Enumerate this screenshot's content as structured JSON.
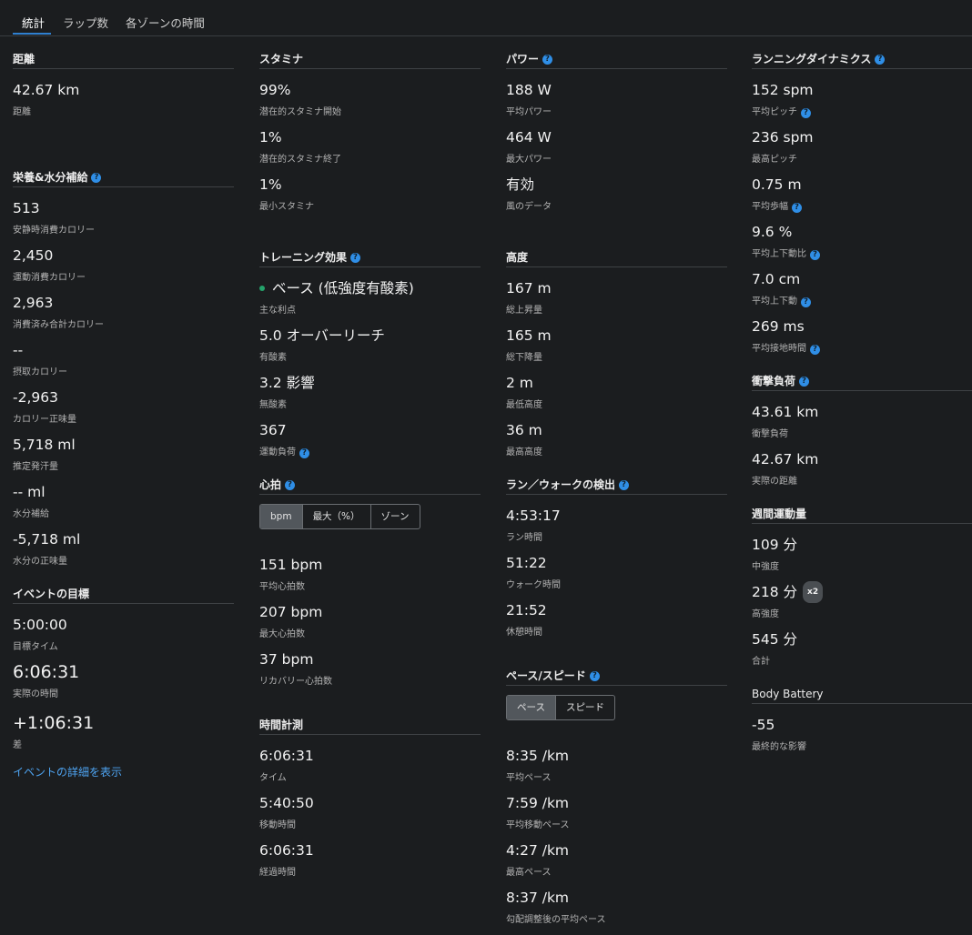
{
  "tabs": [
    "統計",
    "ラップ数",
    "各ゾーンの時間"
  ],
  "col1": {
    "distance": {
      "title": "距離",
      "items": [
        {
          "value": "42.67 km",
          "label": "距離"
        }
      ]
    },
    "nutrition": {
      "title": "栄養&水分補給",
      "items": [
        {
          "value": "513",
          "label": "安静時消費カロリー"
        },
        {
          "value": "2,450",
          "label": "運動消費カロリー"
        },
        {
          "value": "2,963",
          "label": "消費済み合計カロリー"
        },
        {
          "value": "--",
          "label": "摂取カロリー"
        },
        {
          "value": "-2,963",
          "label": "カロリー正味量"
        },
        {
          "value": "5,718 ml",
          "label": "推定発汗量"
        },
        {
          "value": "-- ml",
          "label": "水分補給"
        },
        {
          "value": "-5,718 ml",
          "label": "水分の正味量"
        }
      ]
    },
    "event": {
      "title": "イベントの目標",
      "items": [
        {
          "value": "5:00:00",
          "label": "目標タイム"
        },
        {
          "value": "6:06:31",
          "label": "実際の時間"
        },
        {
          "value": "+1:06:31",
          "label": "差"
        }
      ],
      "link": "イベントの詳細を表示"
    }
  },
  "col2": {
    "stamina": {
      "title": "スタミナ",
      "items": [
        {
          "value": "99%",
          "label": "潜在的スタミナ開始"
        },
        {
          "value": "1%",
          "label": "潜在的スタミナ終了"
        },
        {
          "value": "1%",
          "label": "最小スタミナ"
        }
      ]
    },
    "training": {
      "title": "トレーニング効果",
      "items": [
        {
          "value": "ベース (低強度有酸素)",
          "label": "主な利点"
        },
        {
          "value": "5.0 オーバーリーチ",
          "label": "有酸素"
        },
        {
          "value": "3.2 影響",
          "label": "無酸素"
        },
        {
          "value": "367",
          "label": "運動負荷"
        }
      ],
      "dot_color": "#24a36b"
    },
    "hr": {
      "title": "心拍",
      "toggle": [
        "bpm",
        "最大（%）",
        "ゾーン"
      ],
      "items": [
        {
          "value": "151 bpm",
          "label": "平均心拍数"
        },
        {
          "value": "207 bpm",
          "label": "最大心拍数"
        },
        {
          "value": "37 bpm",
          "label": "リカバリー心拍数"
        }
      ]
    },
    "timing": {
      "title": "時間計測",
      "items": [
        {
          "value": "6:06:31",
          "label": "タイム"
        },
        {
          "value": "5:40:50",
          "label": "移動時間"
        },
        {
          "value": "6:06:31",
          "label": "経過時間"
        }
      ]
    }
  },
  "col3": {
    "power": {
      "title": "パワー",
      "items": [
        {
          "value": "188 W",
          "label": "平均パワー"
        },
        {
          "value": "464 W",
          "label": "最大パワー"
        },
        {
          "value": "有効",
          "label": "風のデータ"
        }
      ]
    },
    "elevation": {
      "title": "高度",
      "items": [
        {
          "value": "167 m",
          "label": "総上昇量"
        },
        {
          "value": "165 m",
          "label": "総下降量"
        },
        {
          "value": "2 m",
          "label": "最低高度"
        },
        {
          "value": "36 m",
          "label": "最高高度"
        }
      ]
    },
    "runwalk": {
      "title": "ラン／ウォークの検出",
      "items": [
        {
          "value": "4:53:17",
          "label": "ラン時間"
        },
        {
          "value": "51:22",
          "label": "ウォーク時間"
        },
        {
          "value": "21:52",
          "label": "休憩時間"
        }
      ]
    },
    "pace": {
      "title": "ペース/スピード",
      "toggle": [
        "ペース",
        "スピード"
      ],
      "items": [
        {
          "value": "8:35 /km",
          "label": "平均ペース"
        },
        {
          "value": "7:59 /km",
          "label": "平均移動ペース"
        },
        {
          "value": "4:27 /km",
          "label": "最高ペース"
        },
        {
          "value": "8:37 /km",
          "label": "勾配調整後の平均ペース"
        }
      ]
    }
  },
  "col4": {
    "dynamics": {
      "title": "ランニングダイナミクス",
      "items": [
        {
          "value": "152 spm",
          "label": "平均ピッチ"
        },
        {
          "value": "236 spm",
          "label": "最高ピッチ"
        },
        {
          "value": "0.75 m",
          "label": "平均歩幅"
        },
        {
          "value": "9.6 %",
          "label": "平均上下動比"
        },
        {
          "value": "7.0 cm",
          "label": "平均上下動"
        },
        {
          "value": "269 ms",
          "label": "平均接地時間"
        }
      ]
    },
    "impact": {
      "title": "衝撃負荷",
      "items": [
        {
          "value": "43.61 km",
          "label": "衝撃負荷"
        },
        {
          "value": "42.67 km",
          "label": "実際の距離"
        }
      ]
    },
    "weekly": {
      "title": "週間運動量",
      "items": [
        {
          "value": "109 分",
          "label": "中強度"
        },
        {
          "value": "218 分",
          "label": "高強度",
          "badge": "x2"
        },
        {
          "value": "545 分",
          "label": "合計"
        }
      ]
    },
    "battery": {
      "title": "Body Battery",
      "items": [
        {
          "value": "-55",
          "label": "最終的な影響"
        }
      ]
    }
  }
}
